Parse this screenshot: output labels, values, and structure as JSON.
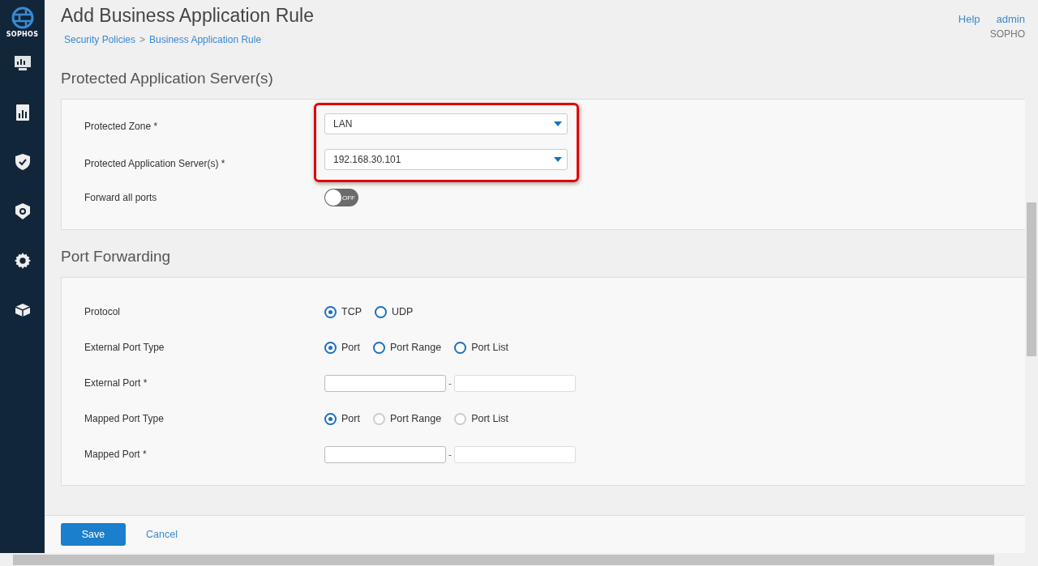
{
  "sidebar": {
    "logo": "SOPHOS"
  },
  "header": {
    "title": "Add Business Application Rule",
    "breadcrumb": [
      {
        "label": "Security Policies",
        "kind": "link"
      },
      {
        "label": ">",
        "kind": "sep"
      },
      {
        "label": "Business Application Rule",
        "kind": "link"
      }
    ],
    "links": [
      "Help",
      "admin"
    ],
    "user_org": "SOPHO"
  },
  "sections": [
    {
      "title": "Protected Application Server(s)",
      "rows": [
        {
          "kind": "select",
          "label": "Protected Zone *",
          "value": "LAN",
          "highlighted": true
        },
        {
          "kind": "select",
          "label": "Protected Application Server(s) *",
          "value": "192.168.30.101",
          "highlighted": true
        },
        {
          "kind": "toggle",
          "label": "Forward all ports",
          "on": false,
          "text": "OFF",
          "highlighted": false
        }
      ]
    },
    {
      "title": "Port Forwarding",
      "rows": [
        {
          "kind": "radio",
          "label": "Protocol",
          "options": [
            {
              "label": "TCP",
              "selected": true,
              "disabled": false
            },
            {
              "label": "UDP",
              "selected": false,
              "disabled": false
            }
          ]
        },
        {
          "kind": "radio",
          "label": "External Port Type",
          "options": [
            {
              "label": "Port",
              "selected": true,
              "disabled": false
            },
            {
              "label": "Port Range",
              "selected": false,
              "disabled": false
            },
            {
              "label": "Port List",
              "selected": false,
              "disabled": false
            }
          ]
        },
        {
          "kind": "range",
          "label": "External Port *",
          "separator": "-",
          "fields": [
            {
              "disabled": false
            },
            {
              "disabled": true
            }
          ]
        },
        {
          "kind": "radio",
          "label": "Mapped Port Type",
          "options": [
            {
              "label": "Port",
              "selected": true,
              "disabled": false
            },
            {
              "label": "Port Range",
              "selected": false,
              "disabled": true
            },
            {
              "label": "Port List",
              "selected": false,
              "disabled": true
            }
          ]
        },
        {
          "kind": "range",
          "label": "Mapped Port *",
          "separator": "-",
          "fields": [
            {
              "disabled": false
            },
            {
              "disabled": true
            }
          ]
        }
      ]
    }
  ],
  "buttons": [
    {
      "label": "Save",
      "kind": "primary"
    },
    {
      "label": "Cancel",
      "kind": "link"
    }
  ]
}
